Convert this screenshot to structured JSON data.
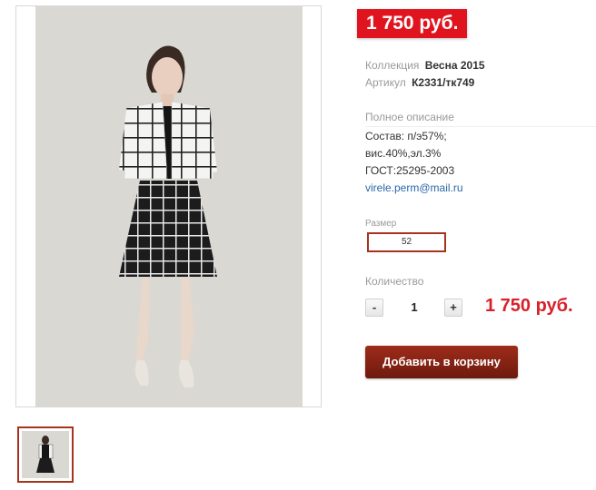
{
  "price_badge": "1 750 руб.",
  "collection": {
    "label": "Коллекция",
    "value": "Весна 2015"
  },
  "article": {
    "label": "Артикул",
    "value": "К2331/тк749"
  },
  "description": {
    "title": "Полное описание",
    "lines": [
      "Состав: п/э57%;",
      "вис.40%,эл.3%",
      "ГОСТ:25295-2003"
    ],
    "email": "virele.perm@mail.ru"
  },
  "size": {
    "label": "Размер",
    "selected": "52"
  },
  "quantity": {
    "label": "Количество",
    "minus": "-",
    "value": "1",
    "plus": "+"
  },
  "total_price": "1 750 руб.",
  "add_to_cart": "Добавить в корзину",
  "colors": {
    "badge": "#e0141e",
    "accent": "#a6331f",
    "price": "#d8202a",
    "link": "#2a67a8"
  }
}
